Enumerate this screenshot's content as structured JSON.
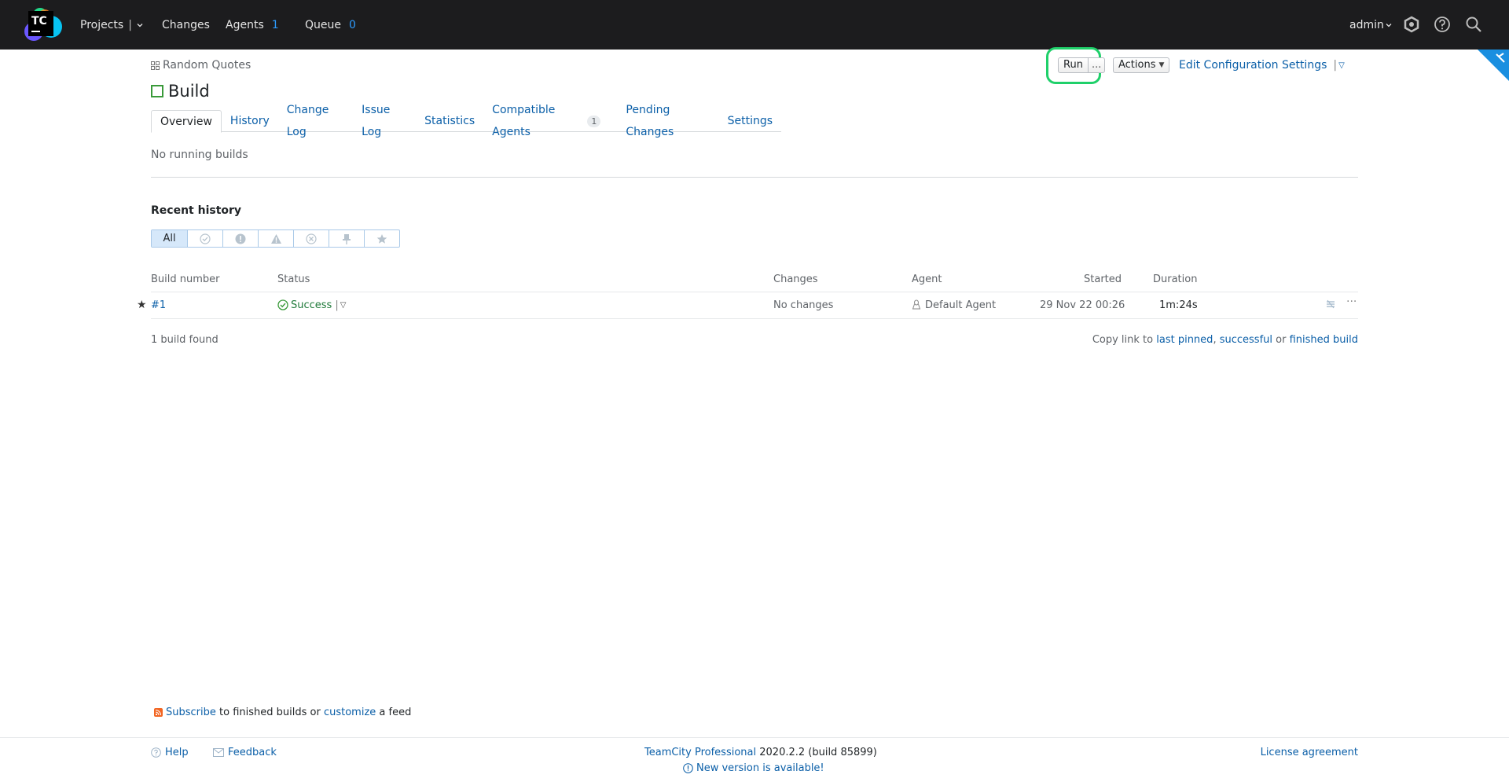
{
  "topbar": {
    "logo_text": "TC",
    "projects_label": "Projects",
    "changes_label": "Changes",
    "agents_label": "Agents",
    "agents_count": "1",
    "queue_label": "Queue",
    "queue_count": "0",
    "user_label": "admin"
  },
  "header": {
    "breadcrumb": "Random Quotes",
    "title": "Build",
    "run_label": "Run",
    "run_more": "...",
    "actions_label": "Actions",
    "edit_config_label": "Edit Configuration Settings"
  },
  "tabs": [
    {
      "label": "Overview"
    },
    {
      "label": "History"
    },
    {
      "label": "Change Log"
    },
    {
      "label": "Issue Log"
    },
    {
      "label": "Statistics"
    },
    {
      "label": "Compatible Agents",
      "badge": "1"
    },
    {
      "label": "Pending Changes"
    },
    {
      "label": "Settings"
    }
  ],
  "running": {
    "text": "No running builds"
  },
  "history": {
    "title": "Recent history",
    "filter_all": "All",
    "filter_icons": [
      "success-filter-icon",
      "failed-filter-icon",
      "warning-filter-icon",
      "cancelled-filter-icon",
      "pinned-filter-icon",
      "starred-filter-icon"
    ],
    "columns": [
      "Build number",
      "Status",
      "Changes",
      "Agent",
      "Started",
      "Duration"
    ],
    "rows": [
      {
        "build_number": "#1",
        "status": "Success",
        "changes": "No changes",
        "agent": "Default Agent",
        "started": "29 Nov 22 00:26",
        "duration": "1m:24s"
      }
    ],
    "found_text": "1 build found",
    "copy_prefix": "Copy link to",
    "copy_last_pinned": "last pinned",
    "copy_successful": "successful",
    "copy_or": "or",
    "copy_finished": "finished build"
  },
  "feed": {
    "subscribe": "Subscribe",
    "middle": "to finished builds or",
    "customize": "customize",
    "suffix": "a feed"
  },
  "footer": {
    "help": "Help",
    "feedback": "Feedback",
    "product": "TeamCity Professional",
    "version": "2020.2.2 (build 85899)",
    "new_version": "New version is available!",
    "license": "License agreement"
  },
  "colors": {
    "topbar_bg": "#1c1c1e",
    "link": "#0b5fa8",
    "count": "#2d9cff",
    "highlight": "#1fd06a",
    "success": "#3a9a3a"
  }
}
